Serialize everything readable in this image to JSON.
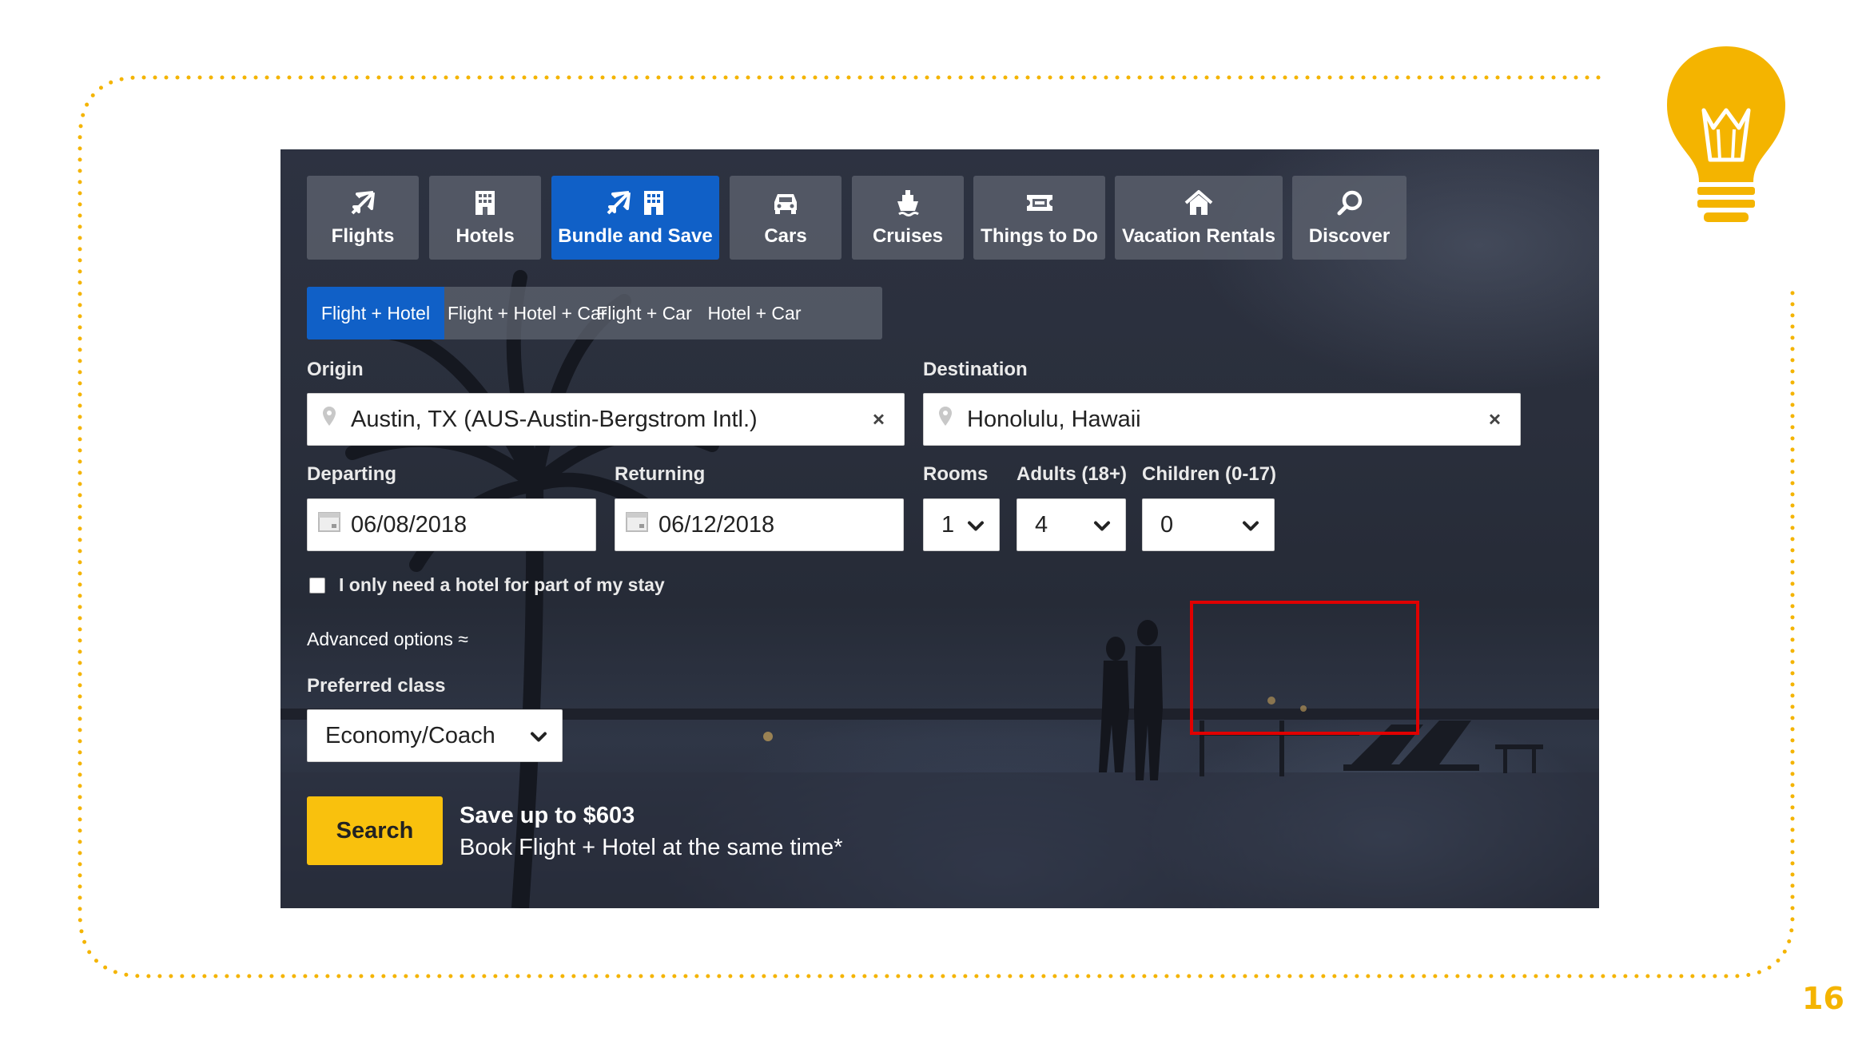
{
  "slide": {
    "page_number": "16",
    "accent_color": "#f4b400",
    "icon": "lightbulb-icon"
  },
  "nav": {
    "tabs": [
      {
        "label": "Flights",
        "icon": "airplane-icon"
      },
      {
        "label": "Hotels",
        "icon": "building-icon"
      },
      {
        "label": "Bundle and Save",
        "icon": "airplane-building-icon",
        "active": true
      },
      {
        "label": "Cars",
        "icon": "car-icon"
      },
      {
        "label": "Cruises",
        "icon": "ship-icon"
      },
      {
        "label": "Things to Do",
        "icon": "ticket-icon"
      },
      {
        "label": "Vacation Rentals",
        "icon": "house-icon"
      },
      {
        "label": "Discover",
        "icon": "search-icon"
      }
    ],
    "active_color": "#1060c7"
  },
  "subtabs": [
    {
      "label": "Flight + Hotel",
      "active": true
    },
    {
      "label": "Flight + Hotel + Car"
    },
    {
      "label": "Flight + Car"
    },
    {
      "label": "Hotel + Car"
    }
  ],
  "form": {
    "origin_label": "Origin",
    "origin_value": "Austin, TX (AUS-Austin-Bergstrom Intl.)",
    "destination_label": "Destination",
    "destination_value": "Honolulu, Hawaii",
    "clear_glyph": "×",
    "departing_label": "Departing",
    "departing_value": "06/08/2018",
    "returning_label": "Returning",
    "returning_value": "06/12/2018",
    "rooms_label": "Rooms",
    "rooms_value": "1",
    "adults_label": "Adults (18+)",
    "adults_value": "4",
    "children_label": "Children (0-17)",
    "children_value": "0",
    "partial_stay_label": "I only need a hotel for part of my stay",
    "partial_stay_checked": false,
    "advanced_label": "Advanced options ≈",
    "class_label": "Preferred class",
    "class_value": "Economy/Coach",
    "search_label": "Search",
    "promo_title": "Save up to $603",
    "promo_subtitle": "Book Flight + Hotel at the same time*"
  },
  "highlight_color": "#e00000",
  "search_color": "#f9c10d"
}
